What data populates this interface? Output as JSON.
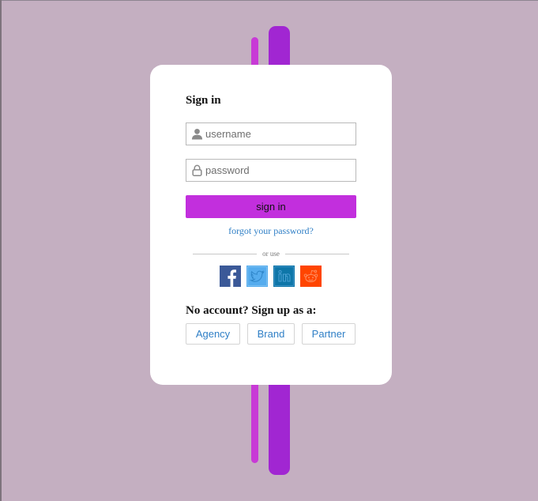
{
  "colors": {
    "background": "#c4afc1",
    "accent_thin_bar": "#c83ad6",
    "accent_thick_bar": "#a126d2",
    "sign_in_button": "#c22fdd",
    "link": "#2f7fc6"
  },
  "card": {
    "title": "Sign in",
    "username": {
      "placeholder": "username",
      "value": "",
      "icon": "user-icon"
    },
    "password": {
      "placeholder": "password",
      "value": "",
      "icon": "lock-icon"
    },
    "sign_in_label": "sign in",
    "forgot_label": "forgot your password?",
    "divider_label": "or use",
    "social": [
      {
        "name": "facebook",
        "icon": "facebook-icon",
        "color": "#3b5998"
      },
      {
        "name": "twitter",
        "icon": "twitter-icon",
        "color": "#55acee"
      },
      {
        "name": "linkedin",
        "icon": "linkedin-icon",
        "color": "#0e76a8"
      },
      {
        "name": "reddit",
        "icon": "reddit-icon",
        "color": "#ff4500"
      }
    ],
    "signup_heading": "No account? Sign up as a:",
    "roles": [
      "Agency",
      "Brand",
      "Partner"
    ]
  }
}
